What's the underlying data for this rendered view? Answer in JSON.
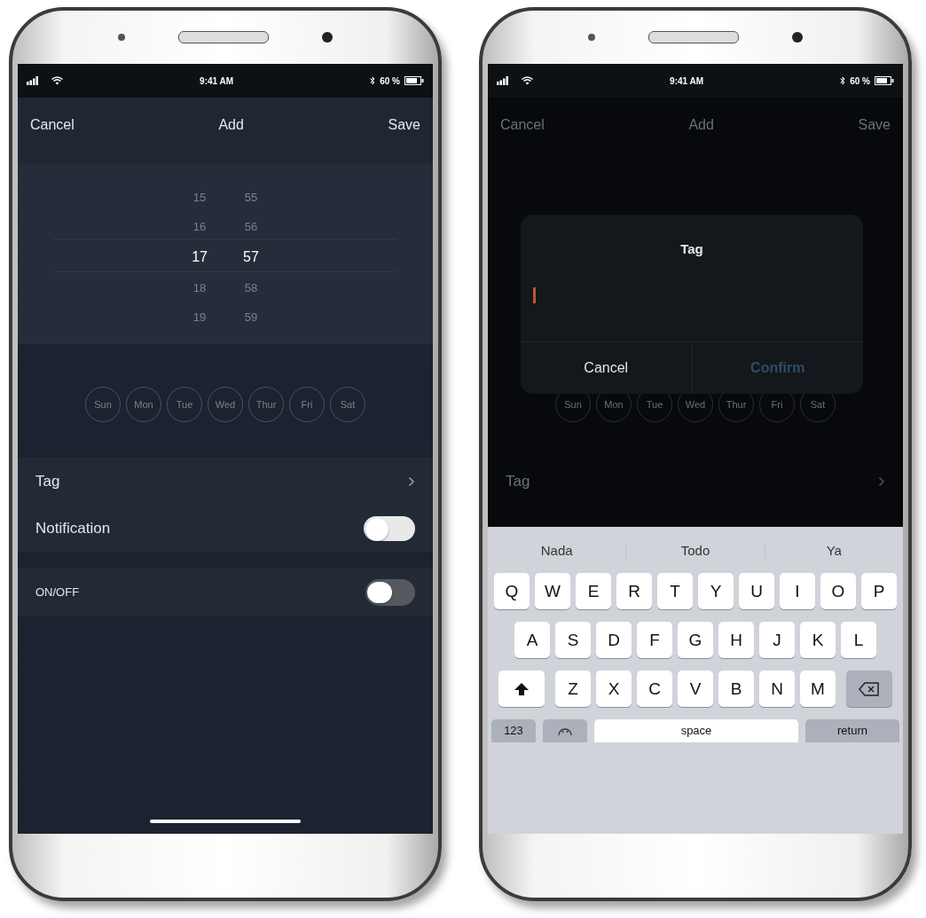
{
  "screens": [
    {
      "status_bar": {
        "time": "9:41 AM",
        "battery": "60 %"
      },
      "nav": {
        "cancel": "Cancel",
        "title": "Add",
        "save": "Save"
      },
      "overlay": false,
      "picker": {
        "hours": [
          {
            "value": "15",
            "selected": false
          },
          {
            "value": "16",
            "selected": false
          },
          {
            "value": "17",
            "selected": true
          },
          {
            "value": "18",
            "selected": false
          },
          {
            "value": "19",
            "selected": false
          }
        ],
        "minutes": [
          {
            "value": "55",
            "selected": false
          },
          {
            "value": "56",
            "selected": false
          },
          {
            "value": "57",
            "selected": true
          },
          {
            "value": "58",
            "selected": false
          },
          {
            "value": "59",
            "selected": false
          }
        ]
      },
      "days": [
        {
          "label": "Sun",
          "selected": false
        },
        {
          "label": "Mon",
          "selected": false
        },
        {
          "label": "Tue",
          "selected": false
        },
        {
          "label": "Wed",
          "selected": false
        },
        {
          "label": "Thur",
          "selected": false
        },
        {
          "label": "Fri",
          "selected": false
        },
        {
          "label": "Sat",
          "selected": false
        }
      ],
      "rows": [
        {
          "kind": "link",
          "label": "Tag"
        },
        {
          "kind": "toggle",
          "label": "Notification",
          "on": false
        },
        {
          "kind": "switch",
          "label": "ON/OFF",
          "on": false
        }
      ]
    },
    {
      "status_bar": {
        "time": "9:41 AM",
        "battery": "60 %"
      },
      "nav": {
        "cancel": "Cancel",
        "title": "Add",
        "save": "Save"
      },
      "overlay": true,
      "days": [
        {
          "label": "Sun",
          "selected": false
        },
        {
          "label": "Mon",
          "selected": false
        },
        {
          "label": "Tue",
          "selected": false
        },
        {
          "label": "Wed",
          "selected": false
        },
        {
          "label": "Thur",
          "selected": false
        },
        {
          "label": "Fri",
          "selected": false
        },
        {
          "label": "Sat",
          "selected": false
        }
      ],
      "rows": [
        {
          "kind": "link",
          "label": "Tag"
        }
      ],
      "dialog": {
        "title": "Tag",
        "cancel": "Cancel",
        "confirm": "Confirm"
      },
      "keyboard": {
        "suggestions": [
          "Nada",
          "Todo",
          "Ya"
        ],
        "rows": [
          [
            {
              "kind": "letter",
              "label": "Q"
            },
            {
              "kind": "letter",
              "label": "W"
            },
            {
              "kind": "letter",
              "label": "E"
            },
            {
              "kind": "letter",
              "label": "R"
            },
            {
              "kind": "letter",
              "label": "T"
            },
            {
              "kind": "letter",
              "label": "Y"
            },
            {
              "kind": "letter",
              "label": "U"
            },
            {
              "kind": "letter",
              "label": "I"
            },
            {
              "kind": "letter",
              "label": "O"
            },
            {
              "kind": "letter",
              "label": "P"
            }
          ],
          [
            {
              "kind": "letter",
              "label": "A"
            },
            {
              "kind": "letter",
              "label": "S"
            },
            {
              "kind": "letter",
              "label": "D"
            },
            {
              "kind": "letter",
              "label": "F"
            },
            {
              "kind": "letter",
              "label": "G"
            },
            {
              "kind": "letter",
              "label": "H"
            },
            {
              "kind": "letter",
              "label": "J"
            },
            {
              "kind": "letter",
              "label": "K"
            },
            {
              "kind": "letter",
              "label": "L"
            }
          ],
          [
            {
              "kind": "shift"
            },
            {
              "kind": "letter",
              "label": "Z"
            },
            {
              "kind": "letter",
              "label": "X"
            },
            {
              "kind": "letter",
              "label": "C"
            },
            {
              "kind": "letter",
              "label": "V"
            },
            {
              "kind": "letter",
              "label": "B"
            },
            {
              "kind": "letter",
              "label": "N"
            },
            {
              "kind": "letter",
              "label": "M"
            },
            {
              "kind": "backspace"
            }
          ]
        ],
        "bottom_keys": [
          {
            "kind": "mode",
            "label": "123"
          },
          {
            "kind": "emoji"
          },
          {
            "kind": "space",
            "label": "space"
          },
          {
            "kind": "return",
            "label": "return"
          }
        ]
      }
    }
  ]
}
